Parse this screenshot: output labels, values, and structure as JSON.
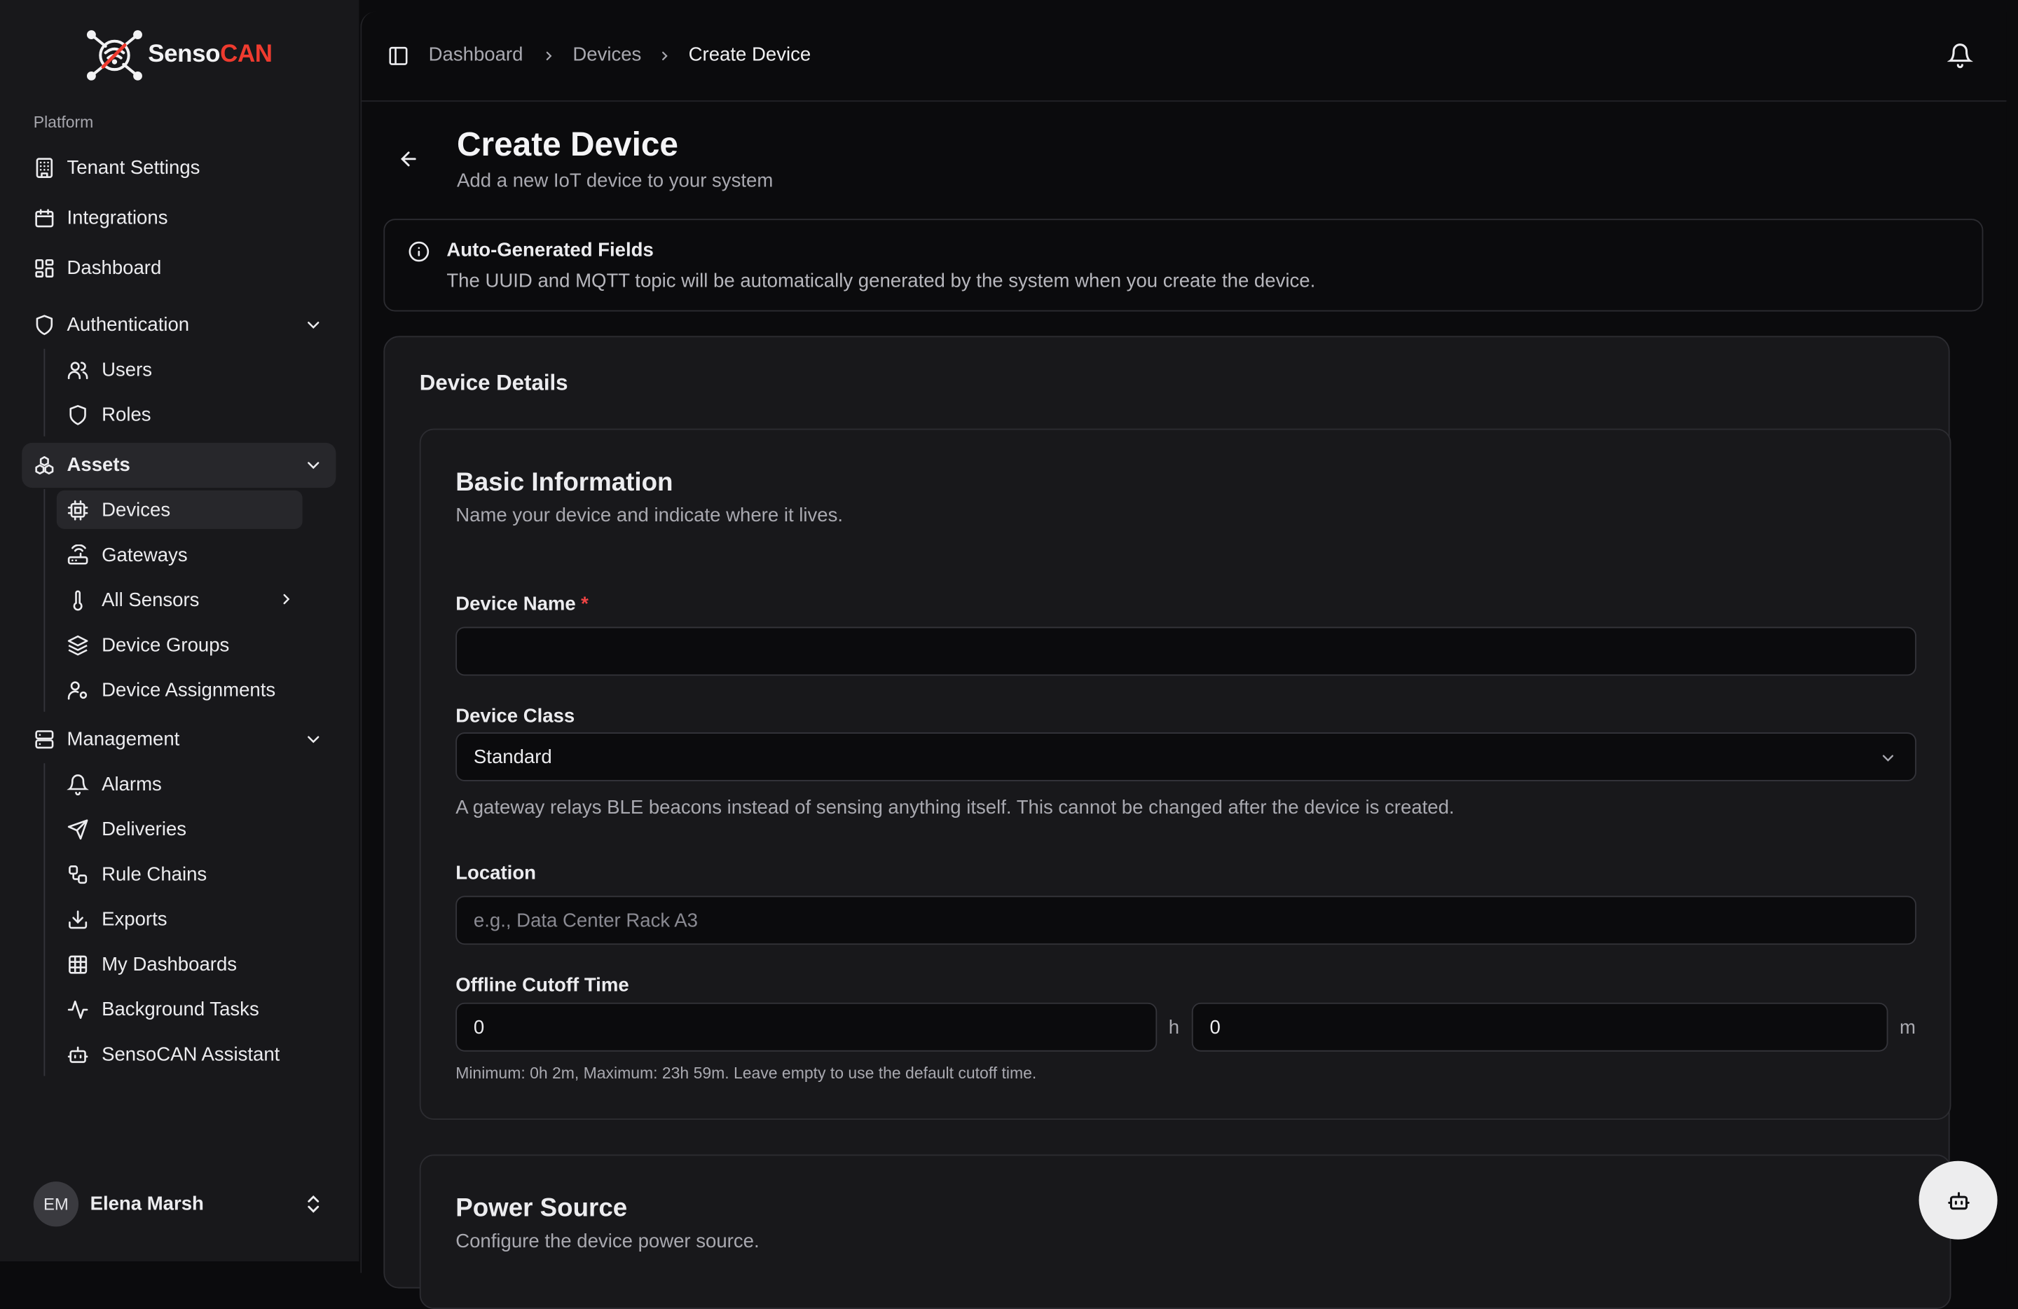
{
  "brand": {
    "name_part1": "Senso",
    "name_part2": "CAN",
    "accent": "#ef3b2f"
  },
  "sidebar": {
    "group_label": "Platform",
    "items": {
      "tenant_settings": "Tenant Settings",
      "integrations": "Integrations",
      "dashboard": "Dashboard",
      "authentication": "Authentication",
      "users": "Users",
      "roles": "Roles",
      "assets": "Assets",
      "devices": "Devices",
      "gateways": "Gateways",
      "all_sensors": "All Sensors",
      "device_groups": "Device Groups",
      "device_assignments": "Device Assignments",
      "management": "Management",
      "alarms": "Alarms",
      "deliveries": "Deliveries",
      "rule_chains": "Rule Chains",
      "exports": "Exports",
      "my_dashboards": "My Dashboards",
      "background_tasks": "Background Tasks",
      "assistant": "SensoCAN Assistant"
    },
    "user": {
      "initials": "EM",
      "name": "Elena Marsh"
    }
  },
  "header": {
    "breadcrumb": [
      "Dashboard",
      "Devices",
      "Create Device"
    ]
  },
  "page": {
    "title": "Create Device",
    "subtitle": "Add a new IoT device to your system"
  },
  "alert": {
    "title": "Auto-Generated Fields",
    "description": "The UUID and MQTT topic will be automatically generated by the system when you create the device."
  },
  "form": {
    "card_title": "Device Details",
    "basic": {
      "title": "Basic Information",
      "description": "Name your device and indicate where it lives.",
      "device_name_label": "Device Name",
      "required_mark": "*",
      "device_name_value": "",
      "device_class_label": "Device Class",
      "device_class_value": "Standard",
      "device_class_help": "A gateway relays BLE beacons instead of sensing anything itself. This cannot be changed after the device is created.",
      "location_label": "Location",
      "location_placeholder": "e.g., Data Center Rack A3",
      "cutoff_label": "Offline Cutoff Time",
      "cutoff_hours": "0",
      "cutoff_minutes": "0",
      "hours_unit": "h",
      "minutes_unit": "m",
      "cutoff_help": "Minimum: 0h 2m, Maximum: 23h 59m. Leave empty to use the default cutoff time."
    },
    "power": {
      "title": "Power Source",
      "description": "Configure the device power source."
    }
  }
}
